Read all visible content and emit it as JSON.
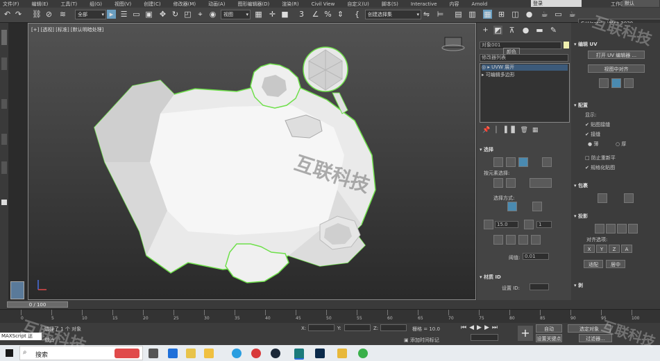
{
  "menu": [
    "文件(F)",
    "编辑(E)",
    "工具(T)",
    "组(G)",
    "视图(V)",
    "创建(C)",
    "修改器(M)",
    "动画(A)",
    "图形编辑器(D)",
    "渲染(R)",
    "Civil View",
    "自定义(U)",
    "脚本(S)",
    "Interactive",
    "内容",
    "Arnold"
  ],
  "login": "登录",
  "workspace_label": "工作区:",
  "workspace_value": "默认",
  "toolbar": {
    "filter": "全部",
    "view": "视图",
    "selection_set": "创建选择集",
    "path": "C:\\Users\\...\\Max 2020"
  },
  "viewport": {
    "label": "[+] [透视] [标准] [默认明暗处理]",
    "watermark": "互联科技"
  },
  "command_panel": {
    "object_name": "对象001",
    "tooltip": "颜色",
    "modifier_list": "修改器列表",
    "stack": [
      "UVW 展开",
      "可编辑多边形"
    ],
    "selection_title": "选择",
    "by_element": "按元素选择:",
    "select_mode": "选择方式:",
    "value_a": "15.0",
    "value_b": "1",
    "threshold_label": "阈值:",
    "threshold_value": "0.01",
    "material_id_title": "材质 ID",
    "set_id_label": "设置 ID:"
  },
  "right_panel": {
    "edit_uv_title": "编辑 UV",
    "open_editor": "打开 UV 编辑器 ...",
    "view_align": "视图中对齐",
    "config_title": "配置",
    "display_label": "显示:",
    "opt_seams": "贴图接缝",
    "opt_peel": "接缝",
    "radio_thin": "薄",
    "radio_thick": "厚",
    "opt_prevent": "防止重新平",
    "opt_normalize": "规格化贴图",
    "wrap_title": "包裹",
    "projection_title": "投影",
    "align_options": "对齐选项:",
    "axis": [
      "X",
      "Y",
      "Z",
      "A"
    ],
    "fit": "适配",
    "center": "居中",
    "peel_title": "剥"
  },
  "timeline": {
    "frame": "0 / 100",
    "ticks": [
      "0",
      "5",
      "10",
      "15",
      "20",
      "25",
      "30",
      "35",
      "40",
      "45",
      "50",
      "55",
      "60",
      "65",
      "70",
      "75",
      "80",
      "85",
      "90",
      "95",
      "100"
    ]
  },
  "status": {
    "maxscript": "MAXScript 迷",
    "selected": "选择了 1 个 对象",
    "undo": "撤消",
    "x_label": "X:",
    "y_label": "Y:",
    "z_label": "Z:",
    "grid": "栅格 = 10.0",
    "add_time_tag": "添加时间标记",
    "auto": "自动",
    "set_key": "设置关键点",
    "selected_obj": "选定对象",
    "filter": "过滤器..."
  },
  "taskbar": {
    "search": "搜索"
  }
}
